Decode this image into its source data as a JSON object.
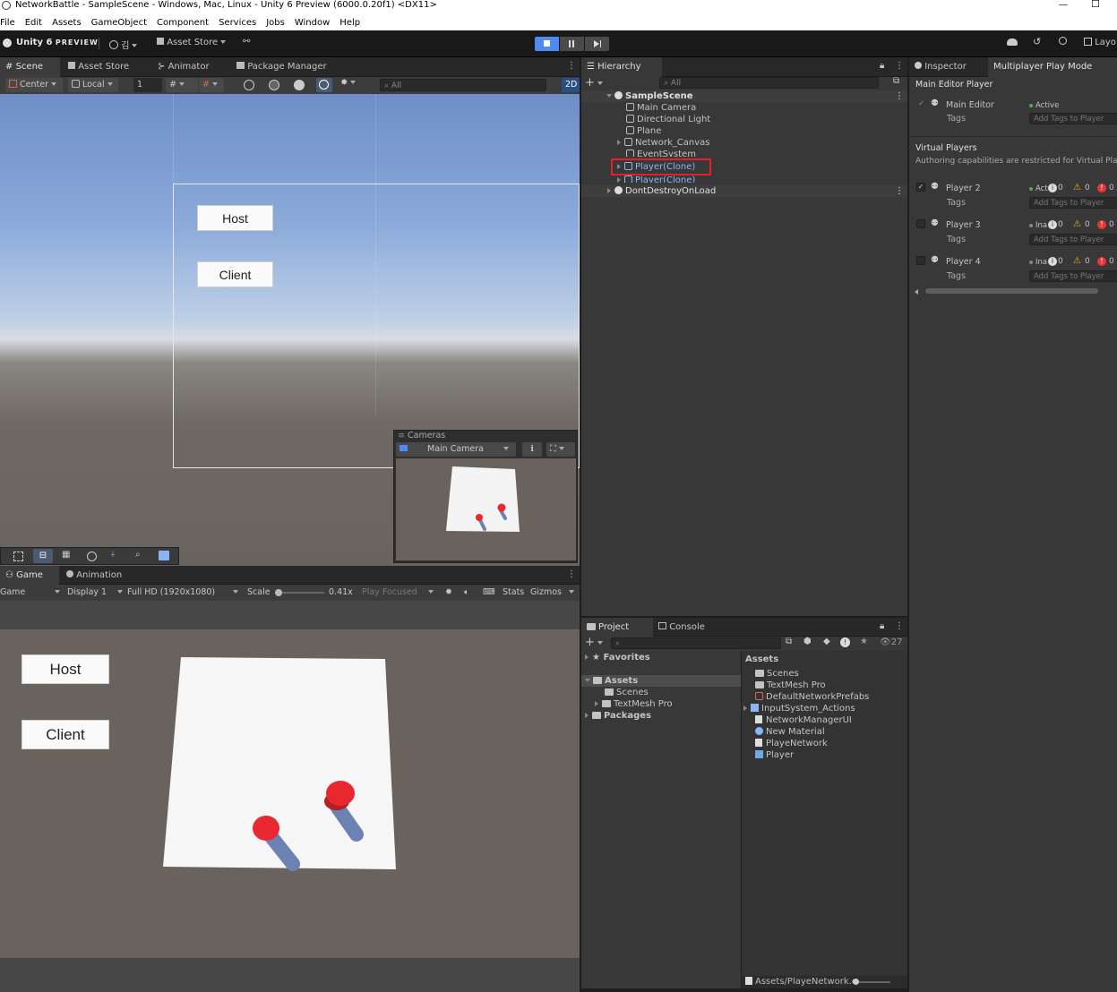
{
  "window": {
    "title": "NetworkBattle - SampleScene - Windows, Mac, Linux - Unity 6 Preview (6000.0.20f1) <DX11>",
    "minimize": "—",
    "maximize": "☐"
  },
  "menu": [
    "File",
    "Edit",
    "Assets",
    "GameObject",
    "Component",
    "Services",
    "Jobs",
    "Window",
    "Help"
  ],
  "toolbar": {
    "brand": "Unity 6",
    "brand_suffix": "PREVIEW",
    "account": "김",
    "asset_store": "Asset Store",
    "layout": "Layo"
  },
  "scene_tabs": {
    "scene": "Scene",
    "asset_store": "Asset Store",
    "animator": "Animator",
    "package_manager": "Package Manager"
  },
  "scene_toolbar": {
    "pivot": "Center",
    "space": "Local",
    "snap": "1",
    "search_placeholder": "All",
    "mode_2d": "2D"
  },
  "scene_view": {
    "host_label": "Host",
    "client_label": "Client"
  },
  "cameras_overlay": {
    "title": "Cameras",
    "camera": "Main Camera"
  },
  "game_tabs": {
    "game": "Game",
    "animation": "Animation"
  },
  "game_toolbar": {
    "mode": "Game",
    "display": "Display 1",
    "resolution": "Full HD (1920x1080)",
    "scale_label": "Scale",
    "scale_value": "0.41x",
    "play_focused": "Play Focused",
    "stats": "Stats",
    "gizmos": "Gizmos"
  },
  "game_view": {
    "host_label": "Host",
    "client_label": "Client"
  },
  "hierarchy": {
    "tab": "Hierarchy",
    "search_placeholder": "All",
    "scene_name": "SampleScene",
    "items": [
      "Main Camera",
      "Directional Light",
      "Plane",
      "Network_Canvas",
      "EventSystem",
      "Player(Clone)",
      "Player(Clone)"
    ],
    "dont_destroy": "DontDestroyOnLoad"
  },
  "inspector": {
    "tab_inspector": "Inspector",
    "tab_mppm": "Multiplayer Play Mode",
    "main_editor_header": "Main Editor Player",
    "main_editor_name": "Main Editor",
    "main_editor_status": "Active",
    "tags_label": "Tags",
    "tags_placeholder": "Add Tags to Player",
    "virtual_header": "Virtual Players",
    "virtual_note": "Authoring capabilities are restricted for Virtual Pla",
    "players": [
      {
        "name": "Player 2",
        "status": "Act",
        "info": "0",
        "warn": "0",
        "err": "0"
      },
      {
        "name": "Player 3",
        "status": "Ina",
        "info": "0",
        "warn": "0",
        "err": "0"
      },
      {
        "name": "Player 4",
        "status": "Ina",
        "info": "0",
        "warn": "0",
        "err": "0"
      }
    ]
  },
  "project": {
    "tab_project": "Project",
    "tab_console": "Console",
    "hidden_count": "27",
    "favorites": "Favorites",
    "assets": "Assets",
    "tree": [
      "Scenes",
      "TextMesh Pro"
    ],
    "packages": "Packages",
    "assets_header": "Assets",
    "files": [
      "Scenes",
      "TextMesh Pro",
      "DefaultNetworkPrefabs",
      "InputSystem_Actions",
      "NetworkManagerUI",
      "New Material",
      "PlayeNetwork",
      "Player"
    ],
    "footer_path": "Assets/PlayeNetwork.c"
  },
  "colors": {
    "highlight": "#e0202a",
    "accent": "#4d8bf0",
    "player_red": "#e8282e",
    "player_blue": "#6b82b3"
  }
}
